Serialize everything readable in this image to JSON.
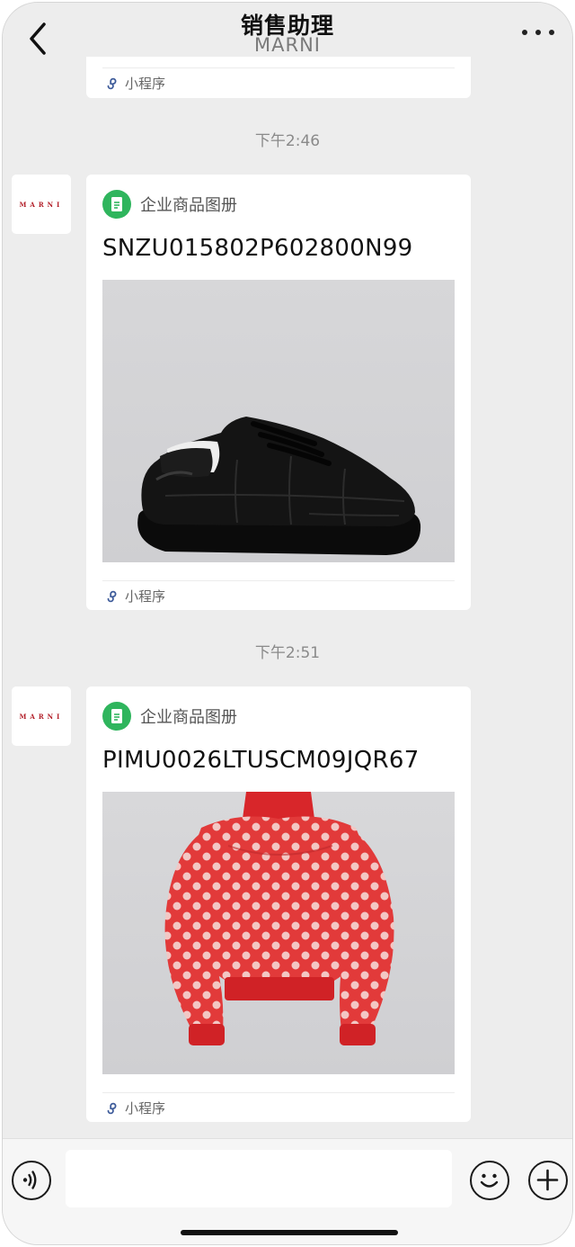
{
  "header": {
    "title": "销售助理",
    "subtitle": "MARNI"
  },
  "avatar_text": "MARNI",
  "mini_program_label": "小程序",
  "messages": [
    {
      "time": "下午2:46",
      "source": "企业商品图册",
      "code": "SNZU015802P602800N99",
      "image_subject": "black padded leather sneaker"
    },
    {
      "time": "下午2:51",
      "source": "企业商品图册",
      "code": "PIMU0026LTUSCM09JQR67",
      "image_subject": "red polka dot mohair sweater"
    }
  ],
  "input": {
    "value": "",
    "placeholder": ""
  },
  "colors": {
    "background": "#ededed",
    "card": "#ffffff",
    "doc_icon": "#2fb55d",
    "brand_red": "#b3202a"
  }
}
